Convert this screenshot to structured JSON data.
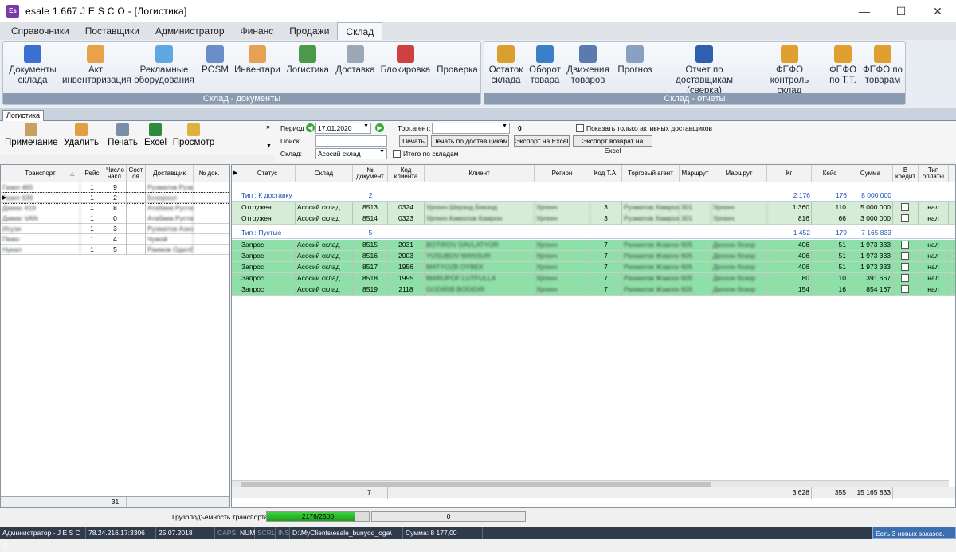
{
  "window": {
    "app_icon": "Es",
    "title": "esale 1.667   J E S C O - [Логистика]"
  },
  "menu": [
    "Справочники",
    "Поставщики",
    "Администратор",
    "Финанс",
    "Продажи",
    "Склад"
  ],
  "ribbon": {
    "group1": {
      "label": "Склад - документы",
      "buttons": [
        [
          "Документы",
          "склада"
        ],
        [
          "Акт",
          "инвентаризация"
        ],
        [
          "Рекламные",
          "оборудования"
        ],
        [
          "POSM",
          ""
        ],
        [
          "Инвентари",
          ""
        ],
        [
          "Логистика",
          ""
        ],
        [
          "Доставка",
          ""
        ],
        [
          "Блокировка",
          ""
        ],
        [
          "Проверка",
          ""
        ]
      ]
    },
    "group2": {
      "label": "Склад - отчеты",
      "buttons": [
        [
          "Остаток",
          "склада"
        ],
        [
          "Оборот",
          "товара"
        ],
        [
          "Движения",
          "товаров"
        ],
        [
          "Прогноз",
          ""
        ],
        [
          "Отчет по",
          "доставщикам (сверка)"
        ],
        [
          "ФЕФО",
          "контроль склад"
        ],
        [
          "ФЕФО",
          "по Т.Т."
        ],
        [
          "ФЕФО по",
          "товарам"
        ]
      ]
    }
  },
  "tab": "Логистика",
  "toolbar": [
    "Примечание",
    "Удалить",
    "Печать",
    "Excel",
    "Просмотр"
  ],
  "filters": {
    "period_label": "Период",
    "period_value": "17.01.2020",
    "search_label": "Поиск:",
    "warehouse_label": "Склад:",
    "warehouse_value": "Асосий склад",
    "agent_label": "Торг.агент:",
    "agent_count": "0",
    "only_active": "Показать только активных доставщиков",
    "total_by_wh": "Итого по складам",
    "print": "Печать",
    "print_by_delivery": "Печать по доставщикам",
    "export_excel": "Экспорт на Excel",
    "export_return": "Экспорт возврат на Excel",
    "more": "»"
  },
  "left_grid": {
    "headers": [
      "Транспорт",
      "Рейс",
      "Число накл.",
      "Сост оя",
      "Доставщик",
      "№ док."
    ],
    "rows": [
      [
        "Газел 465",
        "1",
        "9",
        "",
        "Рузматов Рузм"
      ],
      [
        "Газел 636",
        "1",
        "2",
        "",
        "Бозорхол"
      ],
      [
        "Дамас 419",
        "1",
        "8",
        "",
        "Атабаев Рустам"
      ],
      [
        "Дамас VAN",
        "1",
        "0",
        "",
        "Атабаев Рустам"
      ],
      [
        "Исузи",
        "1",
        "3",
        "",
        "Рузматов Азизб"
      ],
      [
        "Пежо",
        "1",
        "4",
        "",
        "Чужой"
      ],
      [
        "Нукал",
        "1",
        "5",
        "",
        "Раимов Одилб"
      ]
    ],
    "footer_total": "31"
  },
  "main_grid": {
    "headers": [
      "Статус",
      "Склад",
      "№ документ",
      "Код клиента",
      "Клиент",
      "Регион",
      "Код Т.А.",
      "Торговый агент",
      "Маршрут",
      "Маршрут",
      "Кг",
      "Кейс",
      "Сумма",
      "В кредит",
      "Тип оплаты"
    ],
    "groups": [
      {
        "title": "Тип : К доставку",
        "count": "2",
        "kg": "2 176",
        "case": "176",
        "sum": "8 000 000",
        "rows": [
          [
            "Отгружен",
            "Асосий склад",
            "8513",
            "0324",
            "Ургенч Шерзод Бекзод",
            "Ургенч",
            "3",
            "Рузматов Хамроз",
            "301",
            "Ургенч",
            "1 360",
            "110",
            "5 000 000",
            "",
            "нал"
          ],
          [
            "Отгружен",
            "Асосий склад",
            "8514",
            "0323",
            "Ургенч Камолов Камрон",
            "Ургенч",
            "3",
            "Рузматов Хамроз",
            "301",
            "Ургенч",
            "816",
            "66",
            "3 000 000",
            "",
            "нал"
          ]
        ]
      },
      {
        "title": "Тип : Пустые",
        "count": "5",
        "kg": "1 452",
        "case": "179",
        "sum": "7 165 833",
        "rows": [
          [
            "Запрос",
            "Асосий склад",
            "8515",
            "2031",
            "BOTIROV DAVLATYOR",
            "Ургенч",
            "7",
            "Рахматов Жавлонбек",
            "605",
            "Деххон бозор",
            "406",
            "51",
            "1 973 333",
            "",
            "нал"
          ],
          [
            "Запрос",
            "Асосий склад",
            "8516",
            "2003",
            "YUSUBOV MANSUR",
            "Ургенч",
            "7",
            "Рахматов Жавлонбек",
            "605",
            "Деххон бозор",
            "406",
            "51",
            "1 973 333",
            "",
            "нал"
          ],
          [
            "Запрос",
            "Асосий склад",
            "8517",
            "1956",
            "MATYOZB OYBEK",
            "Ургенч",
            "7",
            "Рахматов Жавлонбек",
            "605",
            "Деххон бозор",
            "406",
            "51",
            "1 973 333",
            "",
            "нал"
          ],
          [
            "Запрос",
            "Асосий склад",
            "8518",
            "1995",
            "MARUPOF LUTFULLA",
            "Ургенч",
            "7",
            "Рахматов Жавлонбек",
            "605",
            "Деххон бозор",
            "80",
            "10",
            "391 667",
            "",
            "нал"
          ],
          [
            "Запрос",
            "Асосий склад",
            "8519",
            "2118",
            "GODIRIB BODIDIR",
            "Ургенч",
            "7",
            "Рахматов Жавлонбек",
            "605",
            "Деххон бозор",
            "154",
            "16",
            "854 167",
            "",
            "нал"
          ]
        ]
      }
    ],
    "footer": {
      "docs": "7",
      "kg": "3 628",
      "case": "355",
      "sum": "15 165 833"
    }
  },
  "capacity": {
    "label": "Грузоподъемность транспорта:",
    "value": "2176/2500",
    "fill": 0.87,
    "second": "0"
  },
  "status": [
    "Администратор - J E S C O",
    "78.24.216.17:3306",
    "25.07.2018",
    "CAPS",
    "NUM",
    "SCRL",
    "INS",
    "D:\\MyClients\\esale_bunyod_oga\\",
    "Сумма: 8 177,00"
  ],
  "notification": "Есть 3 новых заказов."
}
